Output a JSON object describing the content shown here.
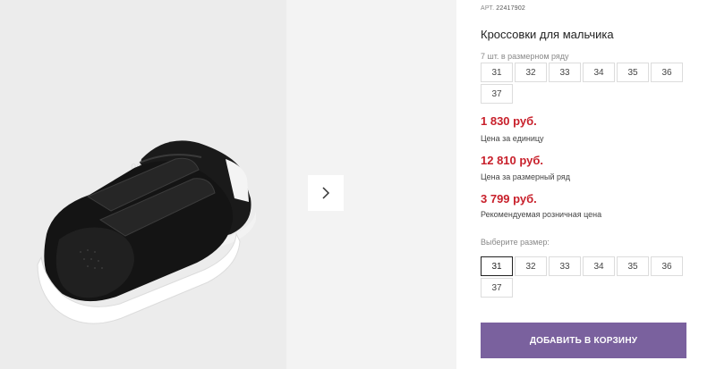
{
  "product": {
    "article_label": "АРТ.",
    "article_number": "22417902",
    "title": "Кроссовки для мальчика",
    "pack_note": "7 шт. в размерном ряду",
    "pack_sizes": [
      "31",
      "32",
      "33",
      "34",
      "35",
      "36",
      "37"
    ]
  },
  "prices": [
    {
      "value": "1 830 руб.",
      "caption": "Цена за единицу"
    },
    {
      "value": "12 810 руб.",
      "caption": "Цена за размерный ряд"
    },
    {
      "value": "3 799 руб.",
      "caption": "Рекомендуемая розничная цена"
    }
  ],
  "size_select": {
    "label": "Выберите размер:",
    "options": [
      "31",
      "32",
      "33",
      "34",
      "35",
      "36",
      "37"
    ],
    "selected": "31"
  },
  "gallery": {
    "next_icon": "chevron-right-icon"
  },
  "cart": {
    "button_label": "ДОБАВИТЬ В КОРЗИНУ"
  },
  "colors": {
    "price": "#c8202b",
    "cart_button": "#7a619e"
  }
}
